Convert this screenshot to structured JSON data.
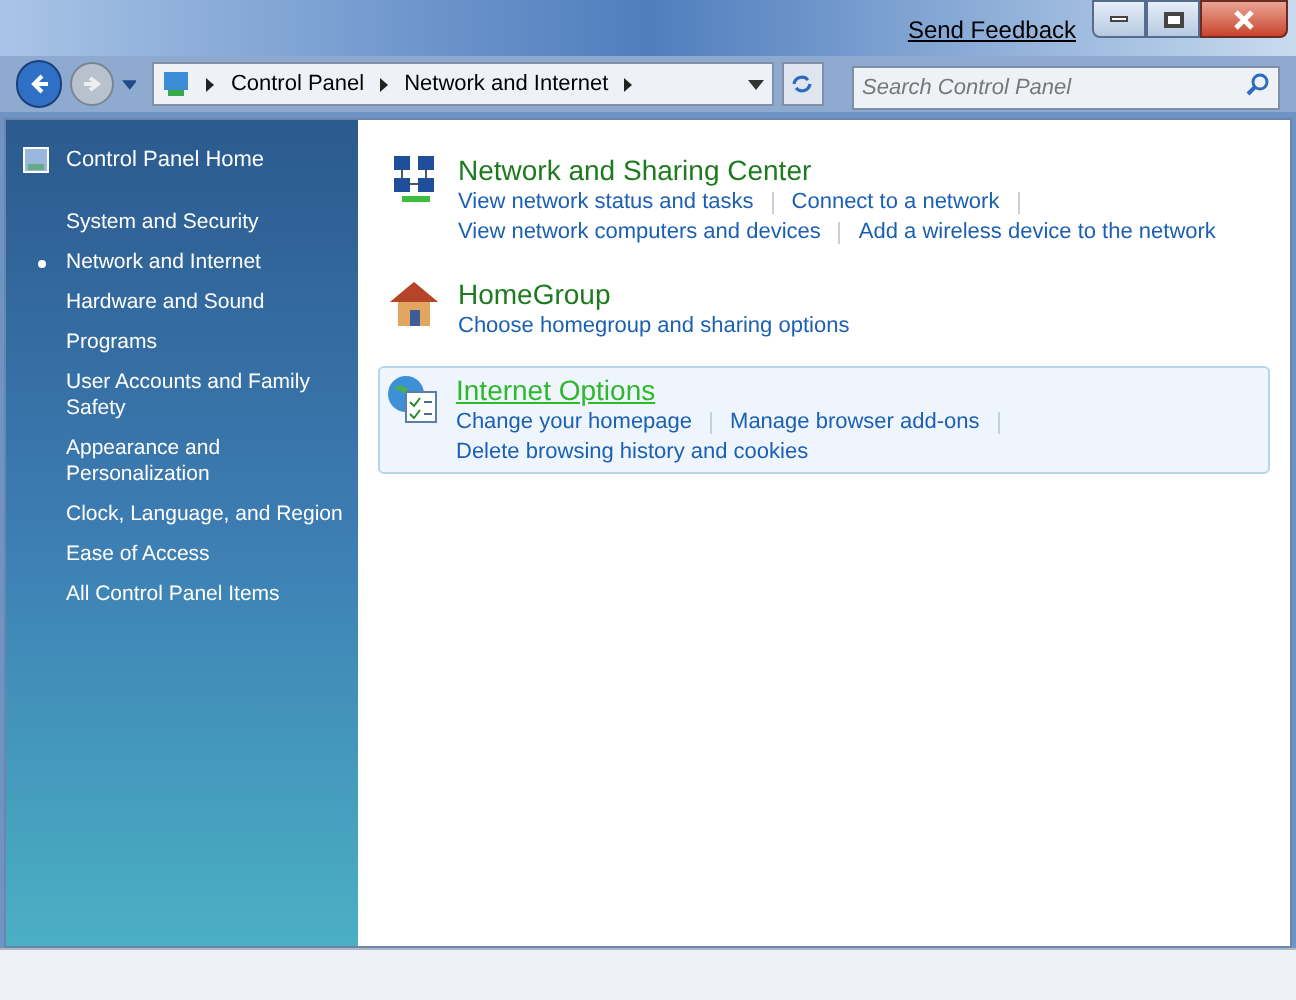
{
  "title_bar": {
    "feedback_link": "Send Feedback"
  },
  "address_bar": {
    "breadcrumbs": [
      "Control Panel",
      "Network and Internet"
    ]
  },
  "search": {
    "placeholder": "Search Control Panel"
  },
  "sidebar": {
    "home": "Control Panel Home",
    "items": [
      {
        "label": "System and Security",
        "selected": false
      },
      {
        "label": "Network and Internet",
        "selected": true
      },
      {
        "label": "Hardware and Sound",
        "selected": false
      },
      {
        "label": "Programs",
        "selected": false
      },
      {
        "label": "User Accounts and Family Safety",
        "selected": false
      },
      {
        "label": "Appearance and Personalization",
        "selected": false
      },
      {
        "label": "Clock, Language, and Region",
        "selected": false
      },
      {
        "label": "Ease of Access",
        "selected": false
      },
      {
        "label": "All Control Panel Items",
        "selected": false
      }
    ]
  },
  "categories": [
    {
      "kind": "network",
      "title": "Network and Sharing Center",
      "hovered": false,
      "lines": [
        [
          "View network status and tasks",
          "Connect to a network"
        ],
        [
          "View network computers and devices",
          "Add a wireless device to the network"
        ]
      ]
    },
    {
      "kind": "home",
      "title": "HomeGroup",
      "hovered": false,
      "lines": [
        [
          "Choose homegroup and sharing options"
        ]
      ]
    },
    {
      "kind": "internet",
      "title": "Internet Options",
      "hovered": true,
      "lines": [
        [
          "Change your homepage",
          "Manage browser add-ons"
        ],
        [
          "Delete browsing history and cookies"
        ]
      ]
    }
  ]
}
